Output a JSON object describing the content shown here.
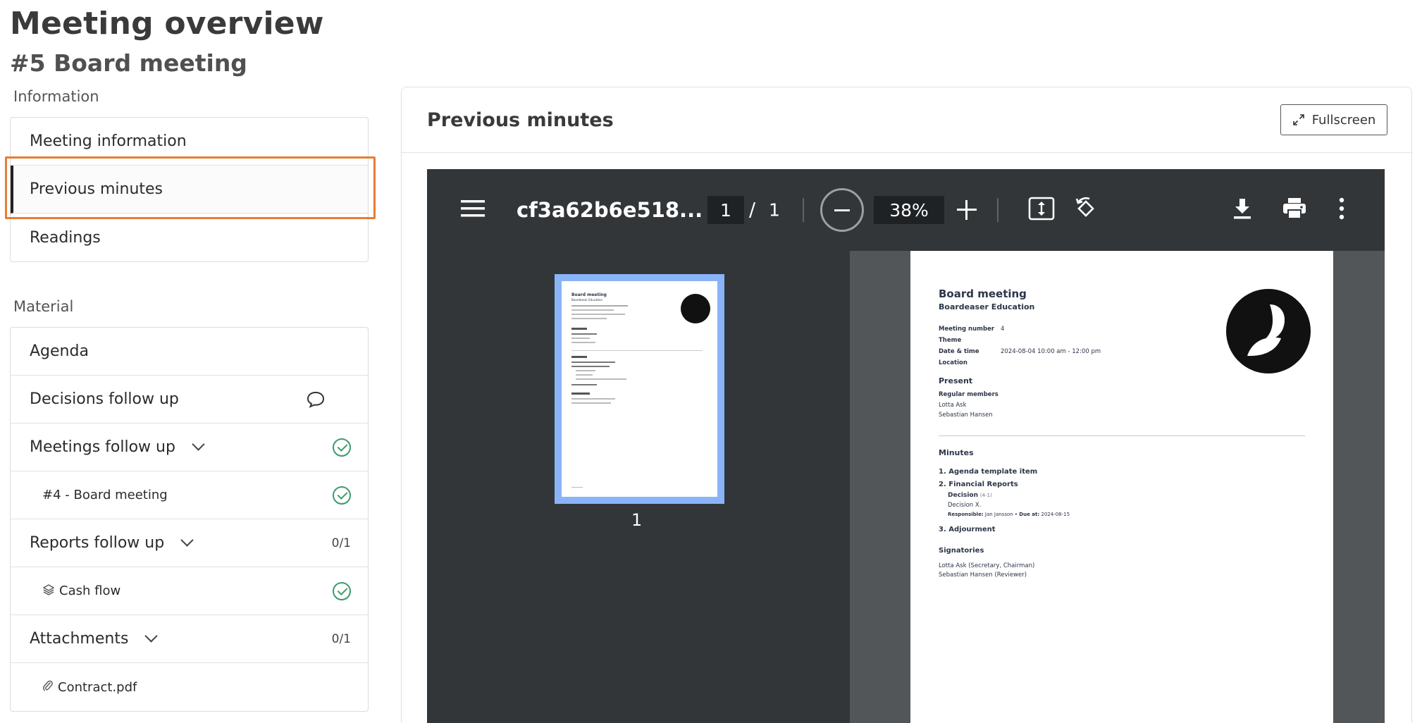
{
  "header": {
    "page_title": "Meeting overview",
    "meeting_title": "#5 Board meeting"
  },
  "nav": {
    "information_label": "Information",
    "information_items": [
      {
        "label": "Meeting information"
      },
      {
        "label": "Previous minutes",
        "active": true
      },
      {
        "label": "Readings"
      }
    ],
    "material_label": "Material",
    "material_items": {
      "agenda": "Agenda",
      "decisions_follow_up": "Decisions follow up",
      "meetings_follow_up": "Meetings follow up",
      "meeting_4": "#4 - Board meeting",
      "reports_follow_up": "Reports follow up",
      "reports_count": "0/1",
      "cash_flow": "Cash flow",
      "attachments": "Attachments",
      "attachments_count": "0/1",
      "contract": "Contract.pdf"
    }
  },
  "panel": {
    "title": "Previous minutes",
    "fullscreen_label": "Fullscreen"
  },
  "pdf_viewer": {
    "filename": "cf3a62b6e518...",
    "current_page": "1",
    "page_separator": "/",
    "total_pages": "1",
    "zoom": "38%",
    "thumbnail_label": "1"
  },
  "document": {
    "title": "Board meeting",
    "organization": "Boardeaser Education",
    "meeting_number_label": "Meeting number",
    "meeting_number": "4",
    "theme_label": "Theme",
    "datetime_label": "Date & time",
    "datetime": "2024-08-04 10:00 am - 12:00 pm",
    "location_label": "Location",
    "present_heading": "Present",
    "regular_members_label": "Regular members",
    "members": [
      "Lotta Ask",
      "Sebastian Hansen"
    ],
    "minutes_heading": "Minutes",
    "item_1": "1. Agenda template item",
    "item_2": "2. Financial Reports",
    "decision_label": "Decision",
    "decision_ref": "(4-1)",
    "decision_text": "Decision X.",
    "responsible_label": "Responsible:",
    "responsible": "Jan Jansson",
    "due_label": "Due at:",
    "due": "2024-08-15",
    "item_3": "3. Adjourment",
    "signatories_heading": "Signatories",
    "signatories": [
      "Lotta Ask (Secretary, Chairman)",
      "Sebastian Hansen (Reviewer)"
    ]
  }
}
